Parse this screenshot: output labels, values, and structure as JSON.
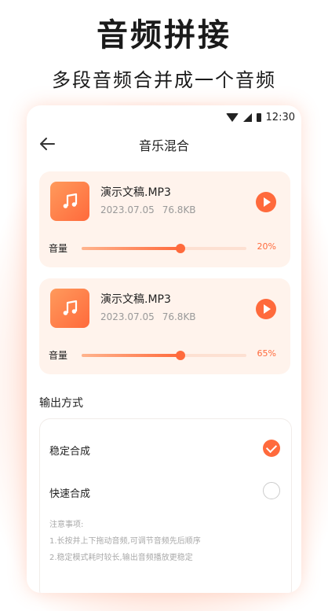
{
  "promo": {
    "title": "音频拼接",
    "subtitle": "多段音频合并成一个音频"
  },
  "status_bar": {
    "time": "12:30"
  },
  "header": {
    "title": "音乐混合"
  },
  "tracks": [
    {
      "name": "演示文稿.MP3",
      "date": "2023.07.05",
      "size": "76.8KB",
      "volume_label": "音量",
      "volume_text": "20%",
      "volume_fraction": 0.6
    },
    {
      "name": "演示文稿.MP3",
      "date": "2023.07.05",
      "size": "76.8KB",
      "volume_label": "音量",
      "volume_text": "65%",
      "volume_fraction": 0.6
    }
  ],
  "output": {
    "title": "输出方式",
    "options": [
      {
        "label": "稳定合成",
        "selected": true
      },
      {
        "label": "快速合成",
        "selected": false
      }
    ],
    "notes_title": "注意事项:",
    "notes": [
      "1.长按并上下拖动音频,可调节音频先后顺序",
      "2.稳定模式耗时较长,输出音频播放更稳定"
    ]
  },
  "colors": {
    "accent": "#ff6a3c",
    "card_bg": "#fff3ec"
  },
  "icons": {
    "back": "arrow-left-icon",
    "file": "music-note-icon",
    "play": "play-icon",
    "check": "check-icon"
  }
}
